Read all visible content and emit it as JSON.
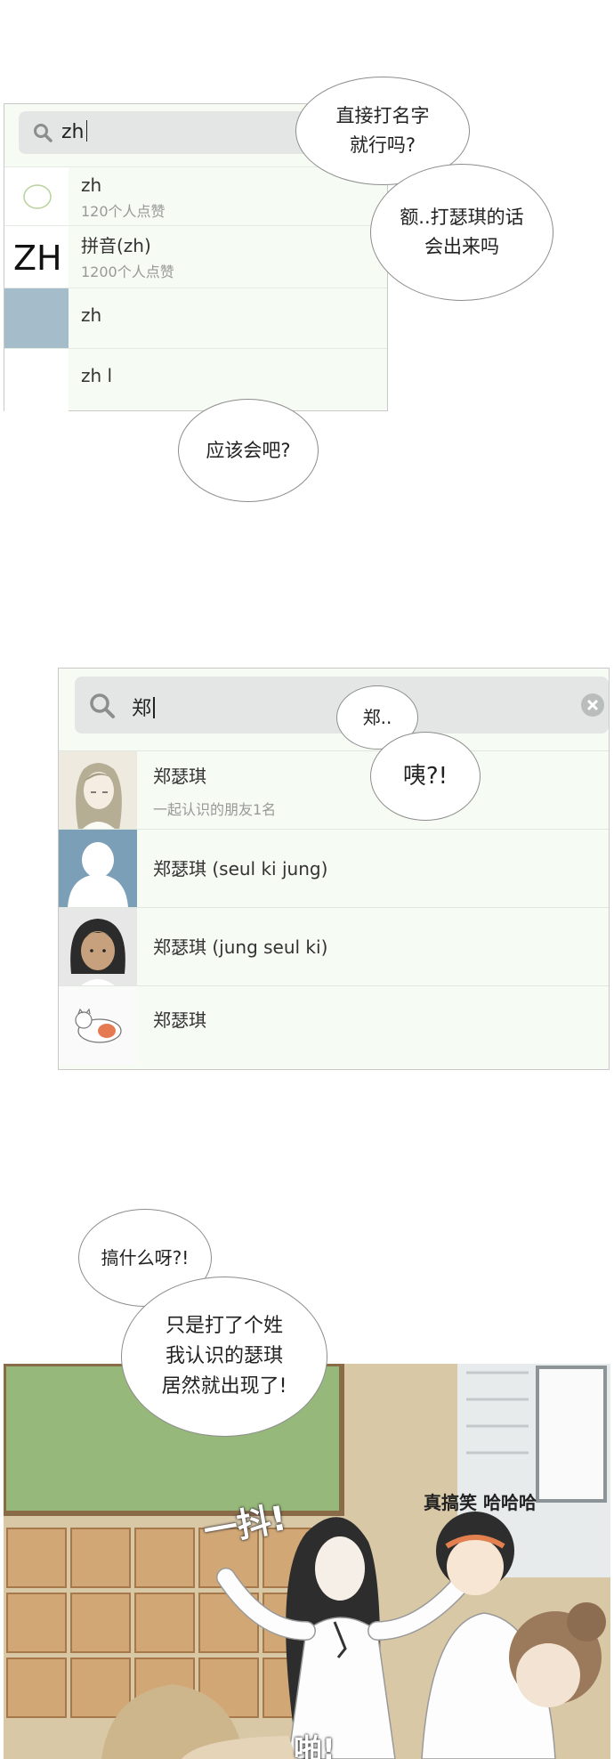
{
  "panel1": {
    "search_query": "zh",
    "results": [
      {
        "title": "zh",
        "subtitle": "120个人点赞",
        "thumb": "circle-icon"
      },
      {
        "title": "拼音(zh)",
        "subtitle": "1200个人点赞",
        "thumb_text": "ZH"
      },
      {
        "title": "zh",
        "subtitle": ""
      },
      {
        "title": "zh l",
        "subtitle": ""
      }
    ]
  },
  "bubbles1": {
    "b1": "直接打名字\n就行吗?",
    "b2": "额..打瑟琪的话\n会出来吗",
    "b3": "应该会吧?"
  },
  "panel2": {
    "search_query": "郑",
    "results": [
      {
        "name": "郑瑟琪",
        "subtitle": "一起认识的朋友1名"
      },
      {
        "name": "郑瑟琪 (seul ki jung)"
      },
      {
        "name": "郑瑟琪 (jung seul ki)"
      },
      {
        "name": "郑瑟琪"
      }
    ]
  },
  "bubbles2": {
    "b1": "郑..",
    "b2": "咦?!"
  },
  "bubbles3": {
    "b1": "搞什么呀?!",
    "b2": "只是打了个姓\n我认识的瑟琪\n居然就出现了!"
  },
  "panel3": {
    "sfx_shake": "一抖!",
    "sfx_laugh": "真搞笑 哈哈哈",
    "sfx_bottom": "啪!"
  },
  "colors": {
    "list_bg": "#f6fbf3",
    "search_bg": "#e3e6e5",
    "chalkboard": "#96b87a",
    "wall": "#d9c8a6"
  }
}
